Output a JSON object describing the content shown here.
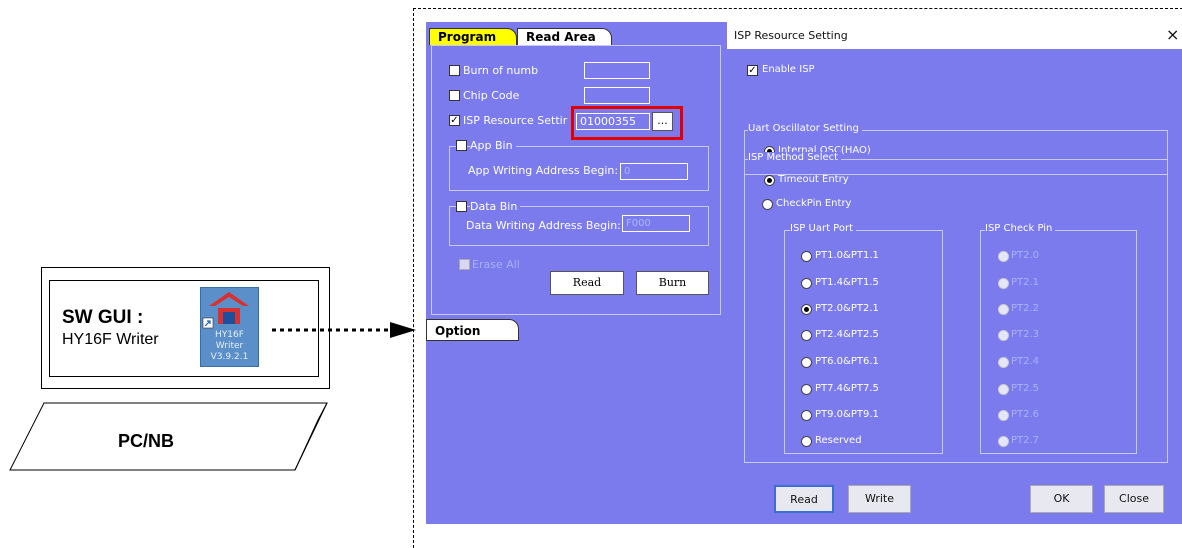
{
  "left_diagram": {
    "gui_title": "SW GUI :",
    "gui_subtitle": "HY16F Writer",
    "icon_line1": "HY16F",
    "icon_line2": "Writer",
    "icon_line3": "V3.9.2.1",
    "pc_label": "PC/NB"
  },
  "program_panel": {
    "tabs": [
      "Program",
      "Read Area"
    ],
    "burn_of_numb": "Burn of numb",
    "chip_code": "Chip Code",
    "isp_resource": "ISP Resource Settir",
    "isp_value": "01000355",
    "isp_browse": "...",
    "app_bin": "App Bin",
    "app_addr_label": "App Writing Address Begin:",
    "app_addr_value": "0",
    "data_bin": "Data Bin",
    "data_addr_label": "Data Writing Address Begin:",
    "data_addr_value": "F000",
    "erase_all": "Erase All",
    "read_btn": "Read",
    "burn_btn": "Burn",
    "option_tab": "Option",
    "isp_checked": true
  },
  "isp_dialog": {
    "title": "ISP Resource Setting",
    "close": "×",
    "enable_isp": "Enable ISP",
    "uart_osc_group": "Uart Oscillator Setting",
    "internal_osc": "Internal OSC(HAO)",
    "method_group": "ISP Method Select",
    "timeout_entry": "Timeout Entry",
    "checkpin_entry": "CheckPin Entry",
    "uart_port_group": "ISP Uart Port",
    "check_pin_group": "ISP Check Pin",
    "uart_ports": [
      "PT1.0&PT1.1",
      "PT1.4&PT1.5",
      "PT2.0&PT2.1",
      "PT2.4&PT2.5",
      "PT6.0&PT6.1",
      "PT7.4&PT7.5",
      "PT9.0&PT9.1",
      "Reserved"
    ],
    "uart_selected_index": 2,
    "check_pins": [
      "PT2.0",
      "PT2.1",
      "PT2.2",
      "PT2.3",
      "PT2.4",
      "PT2.5",
      "PT2.6",
      "PT2.7"
    ],
    "read_btn": "Read",
    "write_btn": "Write",
    "ok_btn": "OK",
    "close_btn": "Close"
  },
  "colors": {
    "panel": "#7b7bee",
    "tab_active": "#ffff00",
    "highlight": "#e00000"
  }
}
